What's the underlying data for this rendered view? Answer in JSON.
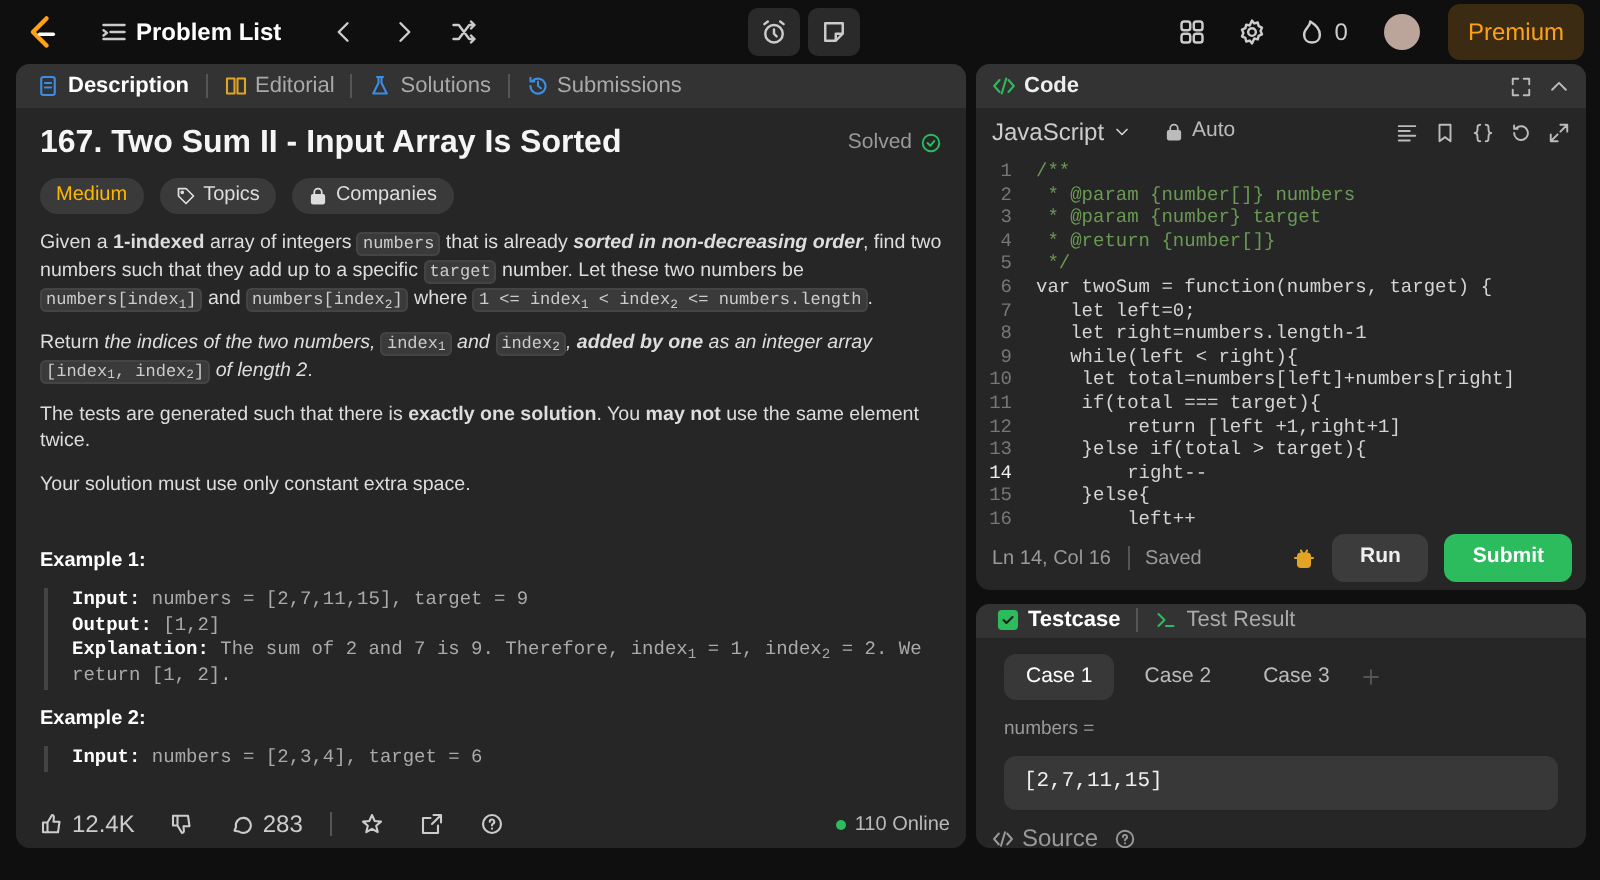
{
  "nav": {
    "title": "Problem List",
    "streak": "0",
    "premium": "Premium"
  },
  "description_panel": {
    "tabs": [
      {
        "label": "Description",
        "selected": true,
        "kind": "doc"
      },
      {
        "label": "Editorial",
        "selected": false,
        "kind": "book"
      },
      {
        "label": "Solutions",
        "selected": false,
        "kind": "flask"
      },
      {
        "label": "Submissions",
        "selected": false,
        "kind": "history"
      }
    ],
    "title": "167. Two Sum II - Input Array Is Sorted",
    "status": "Solved",
    "difficulty": "Medium",
    "tags": [
      {
        "label": "Topics",
        "kind": "tag"
      },
      {
        "label": "Companies",
        "kind": "lock"
      }
    ],
    "paragraphs": [
      [
        {
          "kind": "text",
          "text": "Given a **1-indexed** array of integers "
        },
        {
          "kind": "code",
          "text": "numbers"
        },
        {
          "kind": "text",
          "text": " that is already "
        },
        {
          "kind": "em",
          "text": "**sorted in non-decreasing order**"
        },
        {
          "kind": "text",
          "text": ", find two numbers such that they add up to a specific "
        },
        {
          "kind": "code",
          "text": "target"
        },
        {
          "kind": "text",
          "text": " number. Let these two numbers be "
        },
        {
          "kind": "code",
          "text": "numbers[index$_{1}$]"
        },
        {
          "kind": "text",
          "text": " and "
        },
        {
          "kind": "code",
          "text": "numbers[index$_{2}$]"
        },
        {
          "kind": "text",
          "text": " where "
        },
        {
          "kind": "code",
          "text": "1 <= index$_{1}$ < index$_{2}$ <= numbers.length"
        },
        {
          "kind": "text",
          "text": "."
        }
      ],
      [
        {
          "kind": "text",
          "text": "Return "
        },
        {
          "kind": "em",
          "text": "the indices of the two numbers, "
        },
        {
          "kind": "code",
          "text": "index$_{1}$"
        },
        {
          "kind": "em",
          "text": " and "
        },
        {
          "kind": "code",
          "text": "index$_{2}$"
        },
        {
          "kind": "em",
          "text": ", **added by one** as an integer array "
        },
        {
          "kind": "code",
          "text": "[index$_{1}$, index$_{2}$]"
        },
        {
          "kind": "em",
          "text": " of length 2"
        },
        {
          "kind": "text",
          "text": "."
        }
      ],
      [
        {
          "kind": "text",
          "text": "The tests are generated such that there is **exactly one solution**. You **may not** use the same element twice."
        }
      ],
      [
        {
          "kind": "text",
          "text": "Your solution must use only constant extra space."
        }
      ]
    ],
    "examples": [
      {
        "title": "Example 1:",
        "lines": [
          {
            "label": "Input:",
            "value": "numbers = [2,7,11,15], target = 9"
          },
          {
            "label": "Output:",
            "value": "[1,2]"
          },
          {
            "label": "Explanation:",
            "value": "The sum of 2 and 7 is 9. Therefore, index$_{1}$ = 1, index$_{2}$ = 2. We return [1, 2]."
          }
        ]
      },
      {
        "title": "Example 2:",
        "lines": [
          {
            "label": "Input:",
            "value": "numbers = [2,3,4], target = 6"
          }
        ]
      }
    ],
    "footer": {
      "likes": "12.4K",
      "comments": "283",
      "online": "110 Online"
    }
  },
  "code_panel": {
    "title": "Code",
    "language": "JavaScript",
    "mode": "Auto",
    "lines": [
      {
        "number": "1",
        "code": "/**",
        "kind": "comment",
        "current": false
      },
      {
        "number": "2",
        "code": " * @param {number[]} numbers",
        "kind": "comment",
        "current": false
      },
      {
        "number": "3",
        "code": " * @param {number} target",
        "kind": "comment",
        "current": false
      },
      {
        "number": "4",
        "code": " * @return {number[]}",
        "kind": "comment",
        "current": false
      },
      {
        "number": "5",
        "code": " */",
        "kind": "comment",
        "current": false
      },
      {
        "number": "6",
        "code": "var twoSum = function(numbers, target) {",
        "kind": "code",
        "current": false
      },
      {
        "number": "7",
        "code": "   let left=0;",
        "kind": "code",
        "current": false
      },
      {
        "number": "8",
        "code": "   let right=numbers.length-1",
        "kind": "code",
        "current": false
      },
      {
        "number": "9",
        "code": "   while(left < right){",
        "kind": "code",
        "current": false
      },
      {
        "number": "10",
        "code": "    let total=numbers[left]+numbers[right]",
        "kind": "code",
        "current": false
      },
      {
        "number": "11",
        "code": "    if(total === target){",
        "kind": "code",
        "current": false
      },
      {
        "number": "12",
        "code": "        return [left +1,right+1]",
        "kind": "code",
        "current": false
      },
      {
        "number": "13",
        "code": "    }else if(total > target){",
        "kind": "code",
        "current": false
      },
      {
        "number": "14",
        "code": "        right--",
        "kind": "code",
        "current": true
      },
      {
        "number": "15",
        "code": "    }else{",
        "kind": "code",
        "current": false
      },
      {
        "number": "16",
        "code": "        left++",
        "kind": "code",
        "current": false
      }
    ],
    "cursor": "Ln 14, Col 16",
    "save_state": "Saved",
    "run": "Run",
    "submit": "Submit"
  },
  "test_panel": {
    "tabs": [
      {
        "label": "Testcase",
        "selected": true,
        "kind": "check"
      },
      {
        "label": "Test Result",
        "selected": false,
        "kind": "terminal"
      }
    ],
    "cases": [
      {
        "label": "Case 1",
        "selected": true
      },
      {
        "label": "Case 2",
        "selected": false
      },
      {
        "label": "Case 3",
        "selected": false
      }
    ],
    "param_label": "numbers =",
    "param_value": "[2,7,11,15]",
    "source": "Source"
  }
}
